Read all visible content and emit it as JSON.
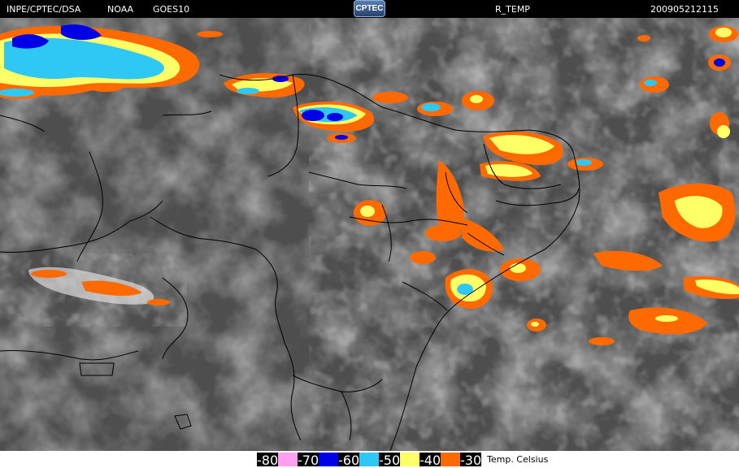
{
  "header": {
    "institution": "INPE/CPTEC/DSA",
    "agency": "NOAA",
    "satellite": "GOES10",
    "logo_text": "CPTEC",
    "product": "R_TEMP",
    "timestamp": "200905212115"
  },
  "legend": {
    "units": "Temp. Celsius",
    "classes": [
      {
        "label": "-80",
        "color": "#ff9ff0"
      },
      {
        "label": "-70",
        "color": "#0000e6"
      },
      {
        "label": "-60",
        "color": "#2fc8f5"
      },
      {
        "label": "-50",
        "color": "#ffff66"
      },
      {
        "label": "-40",
        "color": "#ff6a00"
      },
      {
        "label": "-30",
        "color": ""
      }
    ]
  },
  "colors": {
    "background_cloud_free": "#3f3f3f",
    "cloud_gray": "#8c8c8c",
    "border_lines": "#000000"
  }
}
